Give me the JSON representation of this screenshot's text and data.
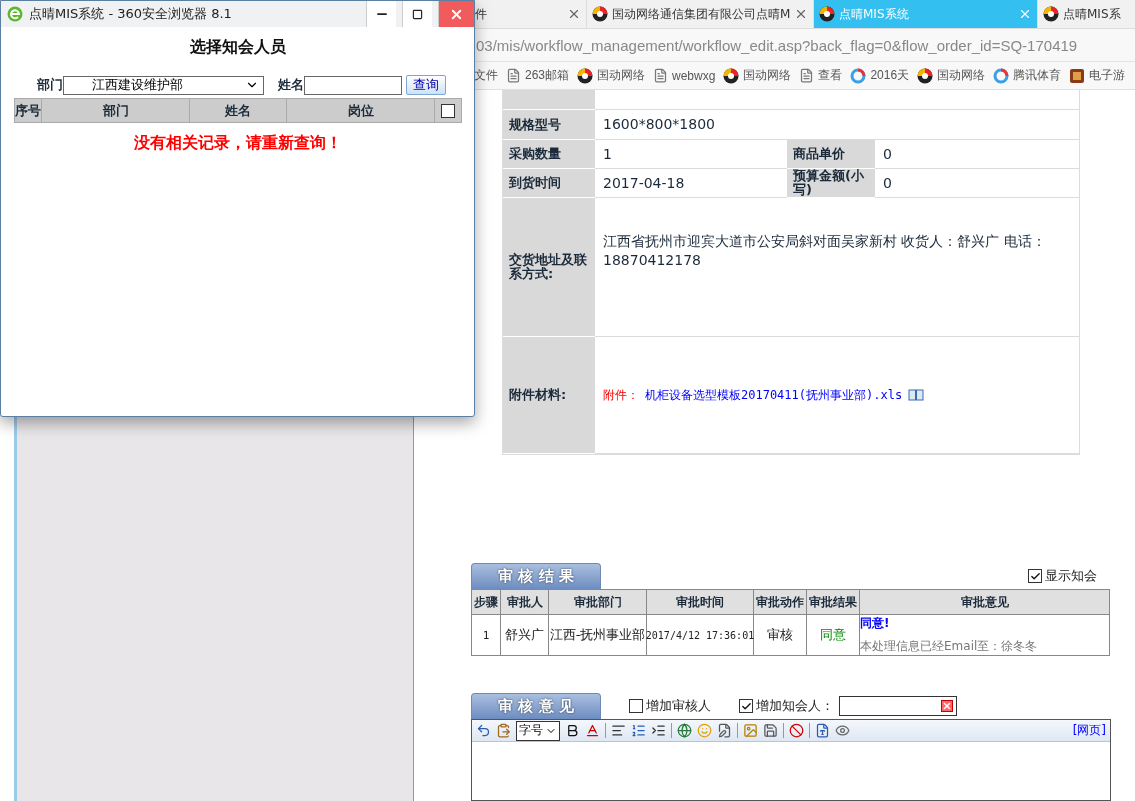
{
  "browser": {
    "tabs": [
      {
        "label": "件",
        "selected": false
      },
      {
        "label": "国动网络通信集团有限公司点晴M",
        "selected": false
      },
      {
        "label": "点晴MIS系统",
        "selected": true
      },
      {
        "label": "点晴MIS系",
        "selected": false
      }
    ],
    "address": "03/mis/workflow_management/workflow_edit.asp?back_flag=0&flow_order_id=SQ-170419",
    "bookmarks": [
      {
        "label": "文件",
        "kind": "plain"
      },
      {
        "label": "263邮箱",
        "kind": "page"
      },
      {
        "label": "国动网络",
        "kind": "logo"
      },
      {
        "label": "webwxg",
        "kind": "page"
      },
      {
        "label": "国动网络",
        "kind": "logo"
      },
      {
        "label": "查看",
        "kind": "page"
      },
      {
        "label": "2016天",
        "kind": "ring"
      },
      {
        "label": "国动网络",
        "kind": "logo"
      },
      {
        "label": "腾讯体育",
        "kind": "ring"
      },
      {
        "label": "电子游",
        "kind": "game"
      }
    ]
  },
  "form": {
    "rows": [
      {
        "kind": "cut"
      },
      {
        "kind": "single",
        "label": "规格型号",
        "value": "1600*800*1800"
      },
      {
        "kind": "pair",
        "label": "采购数量",
        "value": "1",
        "label_2": "商品单价",
        "value_2": "0"
      },
      {
        "kind": "pair",
        "label": "到货时间",
        "value": "2017-04-18",
        "label_2": "预算金额(小写)",
        "value_2": "0"
      },
      {
        "kind": "address",
        "label": "交货地址及联系方式:",
        "value": "江西省抚州市迎宾大道市公安局斜对面吴家新村 收货人：舒兴广 电话：18870412178"
      },
      {
        "kind": "attachment",
        "label": "附件材料:",
        "prefix": "附件：",
        "file": "机柜设备选型模板20170411(抚州事业部).xls"
      }
    ]
  },
  "review_results": {
    "title": "审 核 结 果",
    "show_cc": {
      "label": "显示知会",
      "checked": true
    },
    "columns": [
      "步骤",
      "审批人",
      "审批部门",
      "审批时间",
      "审批动作",
      "审批结果",
      "审批意见"
    ],
    "rows": [
      {
        "step": "1",
        "approver": "舒兴广",
        "department": "江西-抚州事业部",
        "time": "2017/4/12 17:36:01",
        "action": "审核",
        "result": "同意",
        "opinion": "同意!",
        "note": "本处理信息已经Email至：徐冬冬"
      }
    ]
  },
  "review_opinion": {
    "title": "审 核 意 见",
    "add_reviewer": {
      "label": "增加审核人",
      "checked": false
    },
    "add_cc": {
      "label": "增加知会人：",
      "checked": true
    },
    "font_size": "字号",
    "source_link": "[网页]"
  },
  "popup": {
    "title": "点晴MIS系统 - 360安全浏览器 8.1",
    "heading": "选择知会人员",
    "dept_label": "部门",
    "dept_value": "江西建设维护部",
    "name_label": "姓名",
    "search_button": "查询",
    "columns": [
      "序号",
      "部门",
      "姓名",
      "岗位"
    ],
    "select_all": {
      "checked": false
    },
    "empty_message": "没有相关记录，请重新查询！"
  }
}
